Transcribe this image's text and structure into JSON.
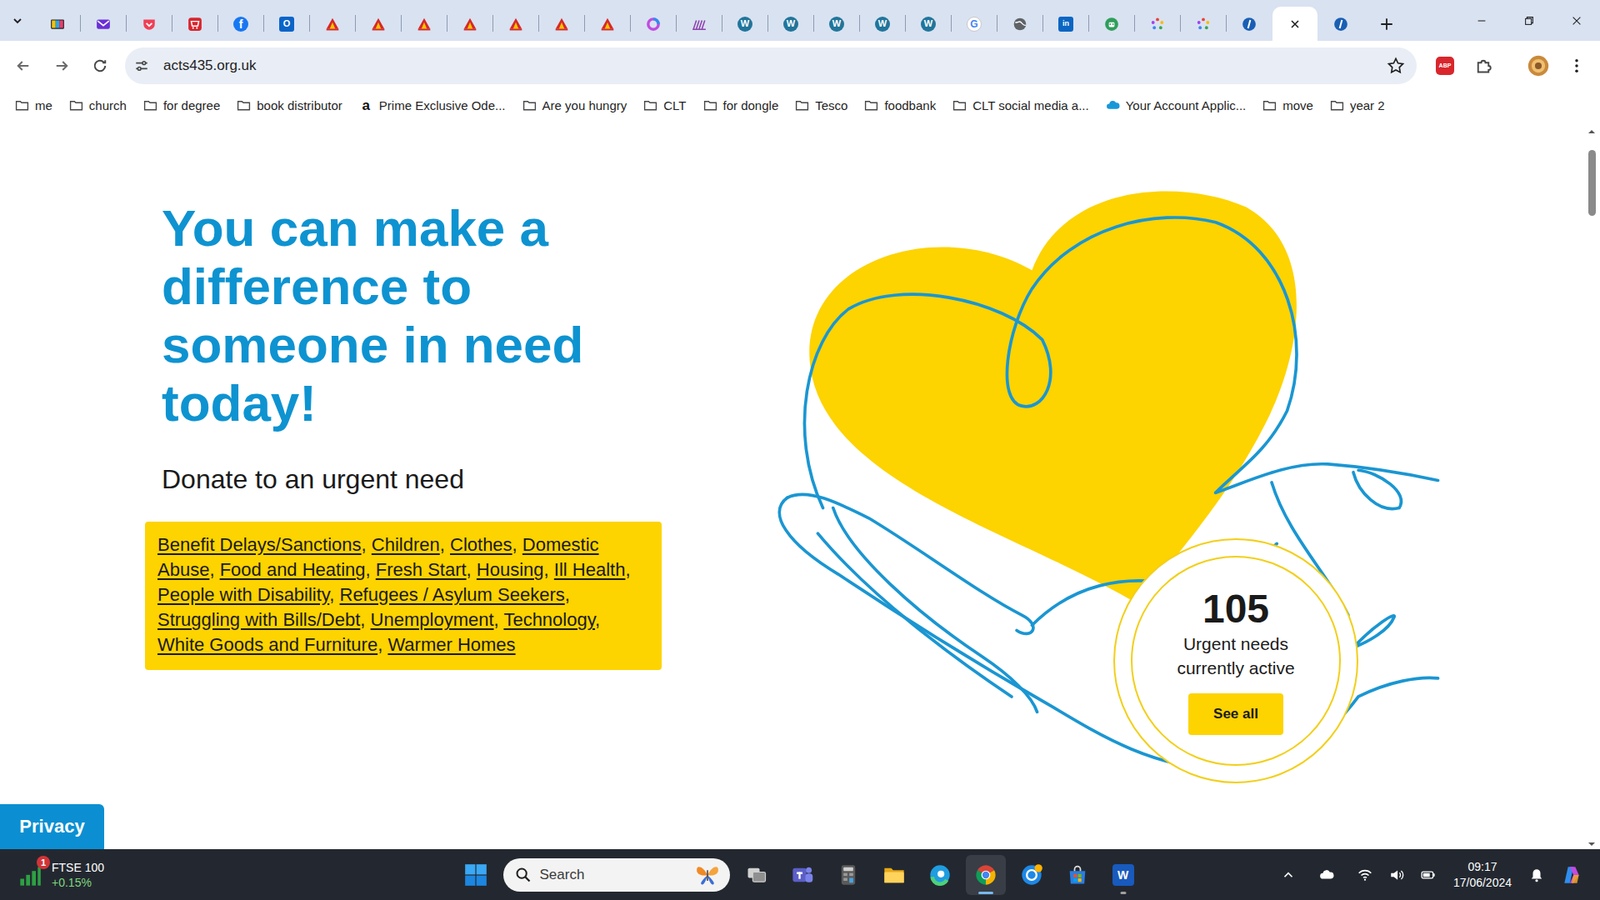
{
  "browser": {
    "tabs": [
      {
        "kind": "tv",
        "selected": false
      },
      {
        "kind": "mail",
        "selected": false
      },
      {
        "kind": "pocket",
        "selected": false
      },
      {
        "kind": "cart",
        "selected": false
      },
      {
        "kind": "facebook",
        "glyph": "f",
        "selected": false
      },
      {
        "kind": "outlook",
        "glyph": "O",
        "selected": false
      },
      {
        "kind": "church",
        "selected": false
      },
      {
        "kind": "church",
        "selected": false
      },
      {
        "kind": "church",
        "selected": false
      },
      {
        "kind": "church",
        "selected": false
      },
      {
        "kind": "church",
        "selected": false
      },
      {
        "kind": "church",
        "selected": false
      },
      {
        "kind": "church",
        "selected": false
      },
      {
        "kind": "copilot",
        "selected": false
      },
      {
        "kind": "bars",
        "selected": false
      },
      {
        "kind": "wordpress",
        "glyph": "W",
        "selected": false
      },
      {
        "kind": "wordpress",
        "glyph": "W",
        "selected": false
      },
      {
        "kind": "wordpress",
        "glyph": "W",
        "selected": false
      },
      {
        "kind": "wordpress",
        "glyph": "W",
        "selected": false
      },
      {
        "kind": "wordpress",
        "glyph": "W",
        "selected": false
      },
      {
        "kind": "google",
        "glyph": "G",
        "selected": false
      },
      {
        "kind": "globe",
        "selected": false
      },
      {
        "kind": "linkedin",
        "glyph": "in",
        "selected": false
      },
      {
        "kind": "android",
        "selected": false
      },
      {
        "kind": "dots",
        "selected": false
      },
      {
        "kind": "dots",
        "selected": false
      },
      {
        "kind": "ring",
        "selected": false
      },
      {
        "kind": "blank",
        "selected": true
      },
      {
        "kind": "ring",
        "selected": false
      }
    ],
    "address": "acts435.org.uk",
    "bookmarked": false,
    "extensions": [
      {
        "kind": "abp",
        "glyph": "ABP"
      },
      {
        "kind": "puzzle"
      }
    ],
    "bookmarks": [
      {
        "label": "me",
        "kind": "folder"
      },
      {
        "label": "church",
        "kind": "folder"
      },
      {
        "label": "for degree",
        "kind": "folder"
      },
      {
        "label": "book distributor",
        "kind": "folder"
      },
      {
        "label": "Prime Exclusive Ode...",
        "kind": "amazon",
        "glyph": "a"
      },
      {
        "label": "Are you hungry",
        "kind": "folder"
      },
      {
        "label": "CLT",
        "kind": "folder"
      },
      {
        "label": "for dongle",
        "kind": "folder"
      },
      {
        "label": "Tesco",
        "kind": "folder"
      },
      {
        "label": "foodbank",
        "kind": "folder"
      },
      {
        "label": "CLT social media a...",
        "kind": "folder"
      },
      {
        "label": "Your Account Applic...",
        "kind": "cloud"
      },
      {
        "label": "move",
        "kind": "folder"
      },
      {
        "label": "year 2",
        "kind": "folder"
      }
    ]
  },
  "page": {
    "heading_lines": [
      "You can make a",
      "difference to",
      "someone in need",
      "today!"
    ],
    "subheading": "Donate to an urgent need",
    "categories": [
      {
        "label": "Benefit Delays/Sanctions",
        "separator": ","
      },
      {
        "label": "Children",
        "separator": ","
      },
      {
        "label": "Clothes",
        "separator": ","
      },
      {
        "label": "Domestic Abuse",
        "separator": ","
      },
      {
        "label": "Food and Heating",
        "separator": ","
      },
      {
        "label": "Fresh Start",
        "separator": ","
      },
      {
        "label": "Housing",
        "separator": ","
      },
      {
        "label": "Ill Health",
        "separator": ","
      },
      {
        "label": "People with Disability",
        "separator": ","
      },
      {
        "label": "Refugees / Asylum Seekers",
        "separator": ","
      },
      {
        "label": "Struggling with Bills/Debt",
        "separator": ","
      },
      {
        "label": "Unemployment",
        "separator": ","
      },
      {
        "label": "Technology",
        "separator": ","
      },
      {
        "label": "White Goods and Furniture",
        "separator": ","
      },
      {
        "label": "Warmer Homes"
      }
    ],
    "counter": {
      "value": "105",
      "label_lines": [
        "Urgent needs",
        "currently active"
      ],
      "button": "See all"
    },
    "privacy": "Privacy",
    "scrollbar": {
      "level": 0.095
    }
  },
  "taskbar": {
    "widget": {
      "badge": "1",
      "title": "FTSE 100",
      "change": "+0.15%"
    },
    "search": {
      "placeholder": "Search"
    },
    "apps": [
      {
        "kind": "task-view",
        "running": false,
        "active": false
      },
      {
        "kind": "teams",
        "running": false,
        "active": false
      },
      {
        "kind": "calculator",
        "running": false,
        "active": false
      },
      {
        "kind": "explorer",
        "running": false,
        "active": false
      },
      {
        "kind": "edge",
        "running": false,
        "active": false
      },
      {
        "kind": "chrome",
        "running": true,
        "active": true
      },
      {
        "kind": "help",
        "running": false,
        "active": false
      },
      {
        "kind": "store",
        "running": false,
        "active": false
      },
      {
        "kind": "word",
        "glyph": "W",
        "running": true,
        "active": false
      }
    ],
    "clock": {
      "time": "09:17",
      "date": "17/06/2024"
    }
  }
}
